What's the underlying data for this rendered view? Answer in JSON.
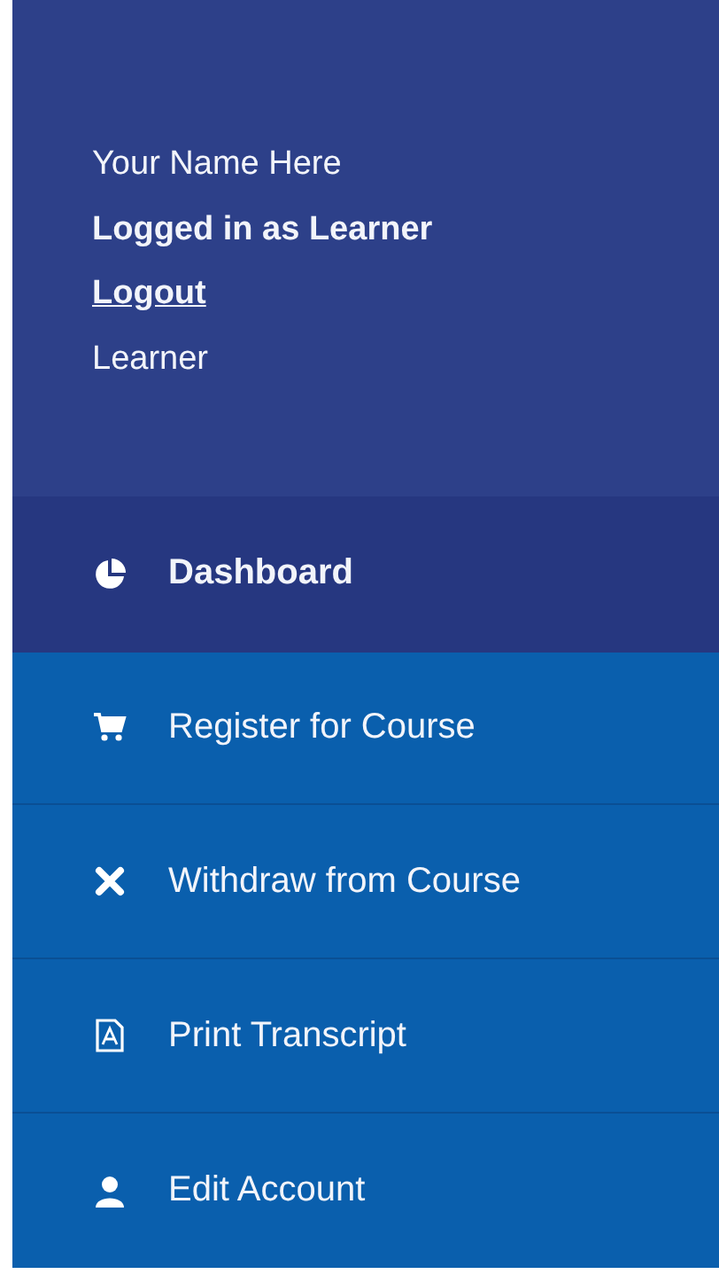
{
  "user": {
    "name": "Your Name Here",
    "status": "Logged in as Learner",
    "logout": "Logout",
    "role": "Learner"
  },
  "menu": [
    {
      "label": "Dashboard",
      "selected": true
    },
    {
      "label": "Register for Course",
      "selected": false
    },
    {
      "label": "Withdraw from Course",
      "selected": false
    },
    {
      "label": "Print Transcript",
      "selected": false
    },
    {
      "label": "Edit Account",
      "selected": false
    }
  ]
}
